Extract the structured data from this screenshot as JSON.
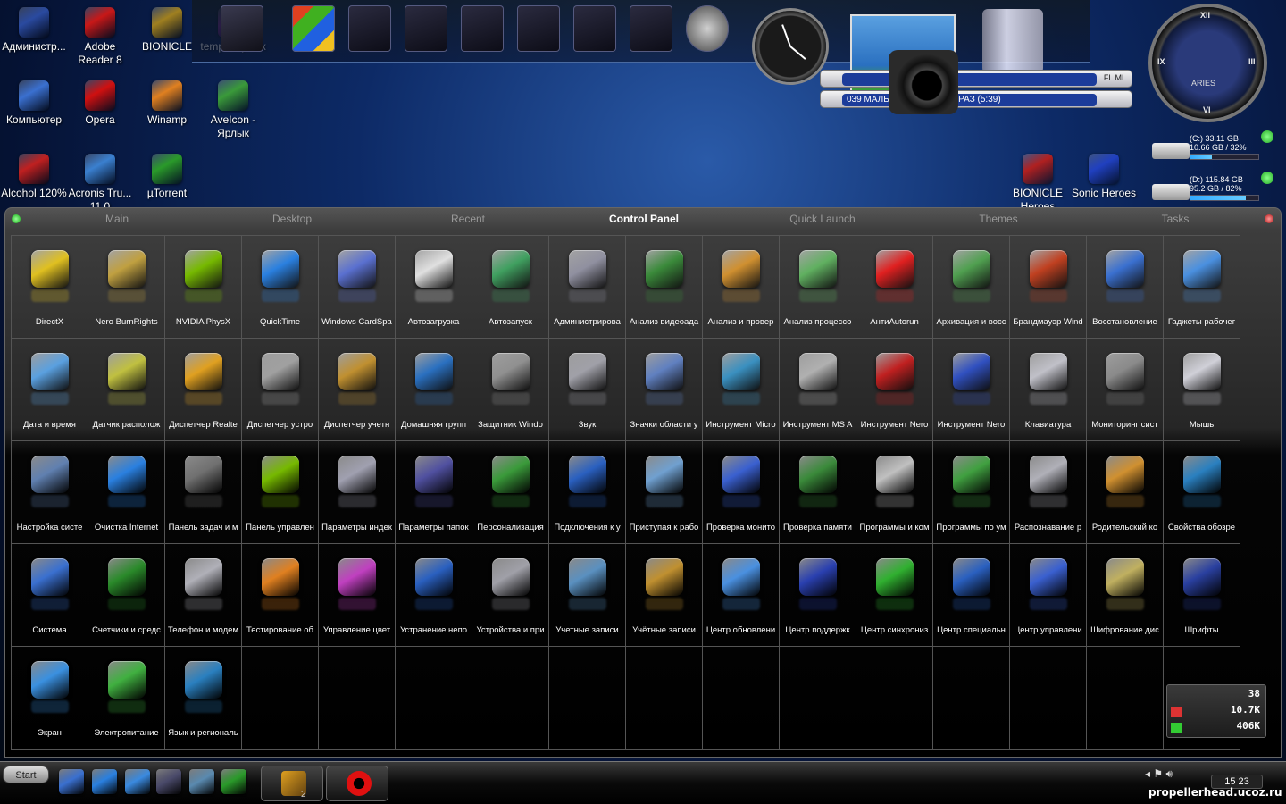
{
  "desktop_icons": [
    {
      "label": "Администр...",
      "color": "#2a4aa0"
    },
    {
      "label": "Adobe Reader 8",
      "color": "#c81818"
    },
    {
      "label": "BIONICLE",
      "color": "#a08020"
    },
    {
      "label": "temp - Ярлык",
      "color": "#7a2aa0"
    },
    {
      "label": "Компьютер",
      "color": "#3a70d0"
    },
    {
      "label": "Opera",
      "color": "#d01010"
    },
    {
      "label": "Winamp",
      "color": "#e08020"
    },
    {
      "label": "AveIcon - Ярлык",
      "color": "#3a9a3a"
    },
    {
      "label": "Alcohol 120%",
      "color": "#c02020"
    },
    {
      "label": "Acronis Tru... 11.0",
      "color": "#3a80d0"
    },
    {
      "label": "µTorrent",
      "color": "#2a9a2a"
    },
    {
      "label": "BIONICLE Heroes",
      "color": "#b02020"
    },
    {
      "label": "Sonic Heroes",
      "color": "#2040c0"
    }
  ],
  "player": {
    "track_1": "",
    "track_2": "039 МАЛЬ... ПОСЛЕДНИЙ РАЗ (5:39)",
    "buttons": "FL ML"
  },
  "bigclock": {
    "numerals": [
      "XII",
      "III",
      "VI",
      "IX"
    ],
    "zodiac": "ARIES"
  },
  "drives": [
    {
      "name": "(C:) 33.11 GB",
      "detail": "10.66 GB / 32%",
      "percent": 32
    },
    {
      "name": "(D:) 115.84 GB",
      "detail": "95.2 GB / 82%",
      "percent": 82
    }
  ],
  "tabs": [
    "Main",
    "Desktop",
    "Recent",
    "Control Panel",
    "Quick Launch",
    "Themes",
    "Tasks"
  ],
  "active_tab": "Control Panel",
  "control_panel_items": [
    {
      "label": "DirectX",
      "color": "#e0c020"
    },
    {
      "label": "Nero BurnRights",
      "color": "#c0a040"
    },
    {
      "label": "NVIDIA PhysX",
      "color": "#76b900"
    },
    {
      "label": "QuickTime",
      "color": "#2a80e0"
    },
    {
      "label": "Windows CardSpa",
      "color": "#5a70d0"
    },
    {
      "label": "Автозагрузка",
      "color": "#e0e0e0"
    },
    {
      "label": "Автозапуск",
      "color": "#40a060"
    },
    {
      "label": "Администрирова",
      "color": "#9090a0"
    },
    {
      "label": "Анализ видеоада",
      "color": "#3a8a3a"
    },
    {
      "label": "Анализ и провер",
      "color": "#d09030"
    },
    {
      "label": "Анализ процессо",
      "color": "#60b060"
    },
    {
      "label": "АнтиAutorun",
      "color": "#e02020"
    },
    {
      "label": "Архивация и восс",
      "color": "#50a050"
    },
    {
      "label": "Брандмауэр Wind",
      "color": "#c04020"
    },
    {
      "label": "Восстановление",
      "color": "#3a70d0"
    },
    {
      "label": "Гаджеты рабочег",
      "color": "#4a90e0"
    },
    {
      "label": "Дата и время",
      "color": "#5aa0e0"
    },
    {
      "label": "Датчик располож",
      "color": "#c0c040"
    },
    {
      "label": "Диспетчер Realte",
      "color": "#e0a020"
    },
    {
      "label": "Диспетчер устро",
      "color": "#a0a0a0"
    },
    {
      "label": "Диспетчер учетн",
      "color": "#c09030"
    },
    {
      "label": "Домашняя групп",
      "color": "#2a70c0"
    },
    {
      "label": "Защитник Windo",
      "color": "#909090"
    },
    {
      "label": "Звук",
      "color": "#a0a0a8"
    },
    {
      "label": "Значки области у",
      "color": "#6080c0"
    },
    {
      "label": "Инструмент Micro",
      "color": "#3a90c0"
    },
    {
      "label": "Инструмент MS A",
      "color": "#b0b0b0"
    },
    {
      "label": "Инструмент Nero",
      "color": "#c02020"
    },
    {
      "label": "Инструмент Nero",
      "color": "#3050c0"
    },
    {
      "label": "Клавиатура",
      "color": "#c0c0c8"
    },
    {
      "label": "Мониторинг сист",
      "color": "#8a8a8a"
    },
    {
      "label": "Мышь",
      "color": "#d0d0d8"
    },
    {
      "label": "Настройка систе",
      "color": "#6080b0"
    },
    {
      "label": "Очистка Internet",
      "color": "#2a80e0"
    },
    {
      "label": "Панель задач и м",
      "color": "#707070"
    },
    {
      "label": "Панель управлен",
      "color": "#76b900"
    },
    {
      "label": "Параметры индек",
      "color": "#a0a0b0"
    },
    {
      "label": "Параметры папок",
      "color": "#5050a0"
    },
    {
      "label": "Персонализация",
      "color": "#3a9a3a"
    },
    {
      "label": "Подключения к у",
      "color": "#2a60c0"
    },
    {
      "label": "Приступая к рабо",
      "color": "#70a0d0"
    },
    {
      "label": "Проверка монито",
      "color": "#3a60d0"
    },
    {
      "label": "Проверка памяти",
      "color": "#3a8a3a"
    },
    {
      "label": "Программы и ком",
      "color": "#c0c0c0"
    },
    {
      "label": "Программы по ум",
      "color": "#40a040"
    },
    {
      "label": "Распознавание р",
      "color": "#b0b0b8"
    },
    {
      "label": "Родительский ко",
      "color": "#d09030"
    },
    {
      "label": "Свойства обозре",
      "color": "#2a80c0"
    },
    {
      "label": "Система",
      "color": "#3a70d0"
    },
    {
      "label": "Счетчики и средс",
      "color": "#2a8a2a"
    },
    {
      "label": "Телефон и модем",
      "color": "#b0b0b8"
    },
    {
      "label": "Тестирование об",
      "color": "#e08020"
    },
    {
      "label": "Управление цвет",
      "color": "#c040c0"
    },
    {
      "label": "Устранение непо",
      "color": "#2a60c0"
    },
    {
      "label": "Устройства и при",
      "color": "#a0a0a8"
    },
    {
      "label": "Учетные записи",
      "color": "#5a90c0"
    },
    {
      "label": "Учётные записи",
      "color": "#c09030"
    },
    {
      "label": "Центр обновлени",
      "color": "#4a90e0"
    },
    {
      "label": "Центр поддержк",
      "color": "#2a40b0"
    },
    {
      "label": "Центр синхрониз",
      "color": "#30b030"
    },
    {
      "label": "Центр специальн",
      "color": "#2a60c0"
    },
    {
      "label": "Центр управлени",
      "color": "#3a60d0"
    },
    {
      "label": "Шифрование дис",
      "color": "#c0b060"
    },
    {
      "label": "Шрифты",
      "color": "#2a40a0"
    },
    {
      "label": "Экран",
      "color": "#3a90e0"
    },
    {
      "label": "Электропитание",
      "color": "#40b040"
    },
    {
      "label": "Язык и региональ",
      "color": "#2a80c0"
    }
  ],
  "netmon": {
    "val1": "38",
    "val2": "10.7K",
    "val3": "406K"
  },
  "taskbar": {
    "start_label": "Start",
    "task_count": "2",
    "clock": "15 23",
    "quicklaunch_colors": [
      "#3a70d0",
      "#2a80e0",
      "#3a8ae0",
      "#4a4a6a",
      "#5a8ab0",
      "#2a9a2a"
    ]
  },
  "watermark": "propellerhead.ucoz.ru"
}
